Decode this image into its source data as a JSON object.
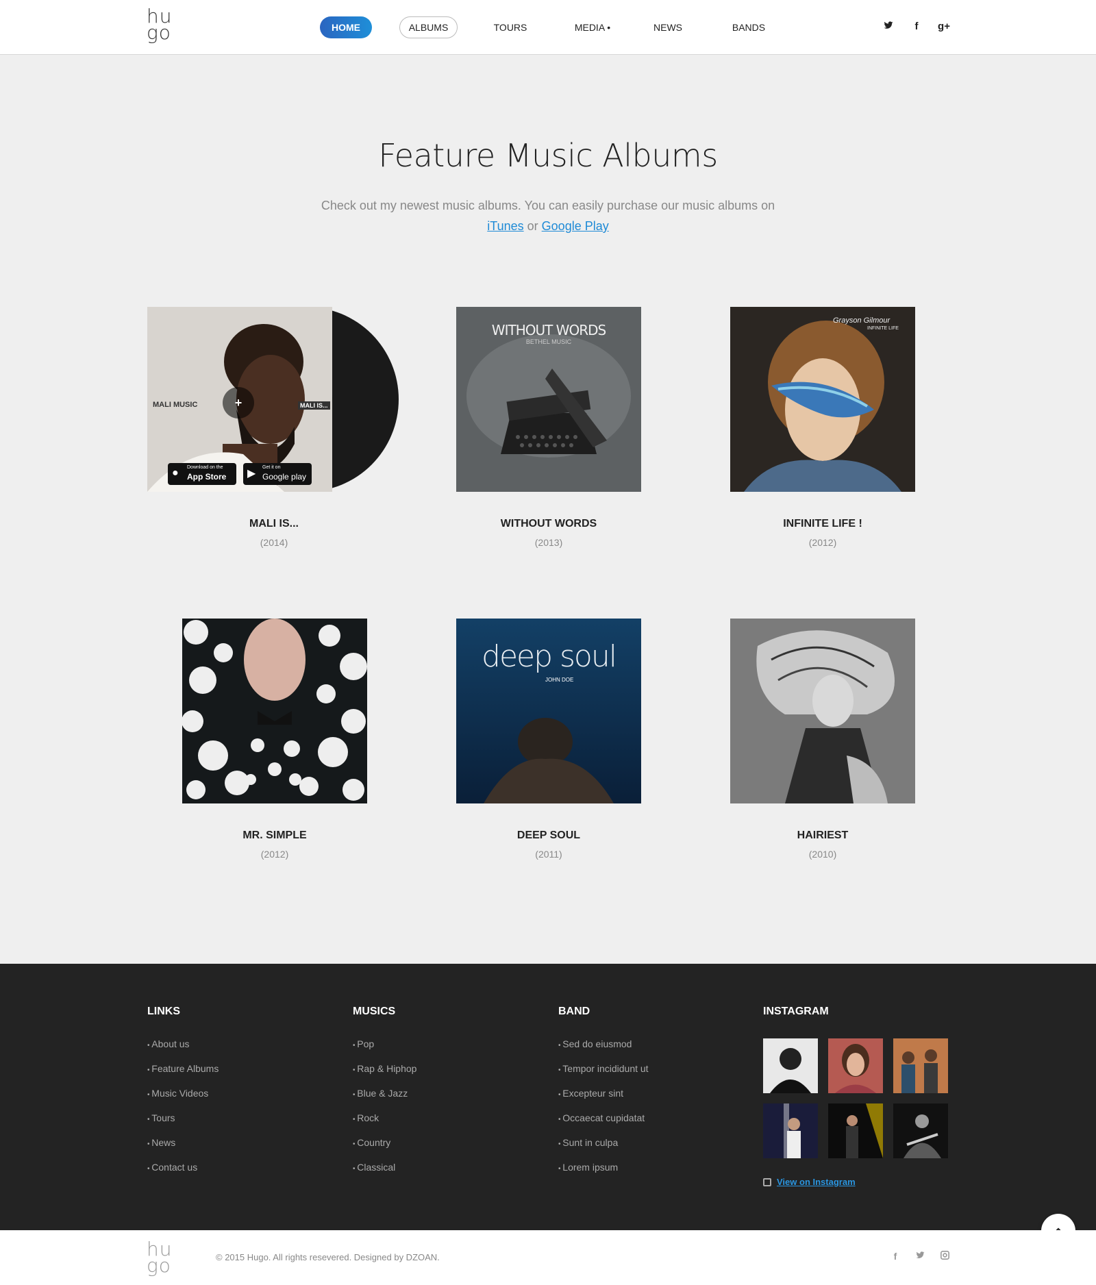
{
  "header": {
    "logo_line1": "hu",
    "logo_line2": "go",
    "nav": [
      "HOME",
      "ALBUMS",
      "TOURS",
      "MEDIA •",
      "NEWS",
      "BANDS"
    ],
    "social_icons": [
      "twitter-icon",
      "facebook-icon",
      "google-plus-icon"
    ]
  },
  "hero": {
    "title": "Feature Music Albums",
    "subtitle": "Check out my newest music albums. You can easily purchase our music albums on",
    "link1": "iTunes",
    "or_text": "or",
    "link2": "Google Play"
  },
  "albums": [
    {
      "title": "MALI IS...",
      "year": "(2014)",
      "cover_text": "MALI MUSIC",
      "cover_text2": "MALI IS...",
      "store1_small": "Download on the",
      "store1": "App Store",
      "store2_small": "Get it on",
      "store2": "Google play"
    },
    {
      "title": "WITHOUT WORDS",
      "year": "(2013)",
      "cover_text": "WITHOUT WORDS",
      "cover_text2": "BETHEL MUSIC"
    },
    {
      "title": "INFINITE LIFE !",
      "year": "(2012)",
      "cover_text": "Grayson Gilmour",
      "cover_text2": "INFINITE LIFE"
    },
    {
      "title": "MR. SIMPLE",
      "year": "(2012)"
    },
    {
      "title": "DEEP SOUL",
      "year": "(2011)",
      "cover_text": "deep soul",
      "cover_text2": "JOHN DOE"
    },
    {
      "title": "HAIRIEST",
      "year": "(2010)"
    }
  ],
  "footer": {
    "links_head": "LINKS",
    "links": [
      "About us",
      "Feature Albums",
      "Music Videos",
      "Tours",
      "News",
      "Contact us"
    ],
    "musics_head": "MUSICS",
    "musics": [
      "Pop",
      "Rap & Hiphop",
      "Blue & Jazz",
      "Rock",
      "Country",
      "Classical"
    ],
    "band_head": "BAND",
    "band": [
      "Sed do eiusmod",
      "Tempor incididunt ut",
      "Excepteur sint",
      "Occaecat cupidatat",
      "Sunt in culpa",
      "Lorem ipsum"
    ],
    "instagram_head": "INSTAGRAM",
    "instagram_link": "View on Instagram"
  },
  "bottom": {
    "copyright": "© 2015 Hugo. All rights resevered. Designed by DZOAN.",
    "to_top": "^"
  },
  "colors": {
    "accent": "#1e8ad6",
    "footer_bg": "#232323",
    "page_bg": "#efefef"
  }
}
